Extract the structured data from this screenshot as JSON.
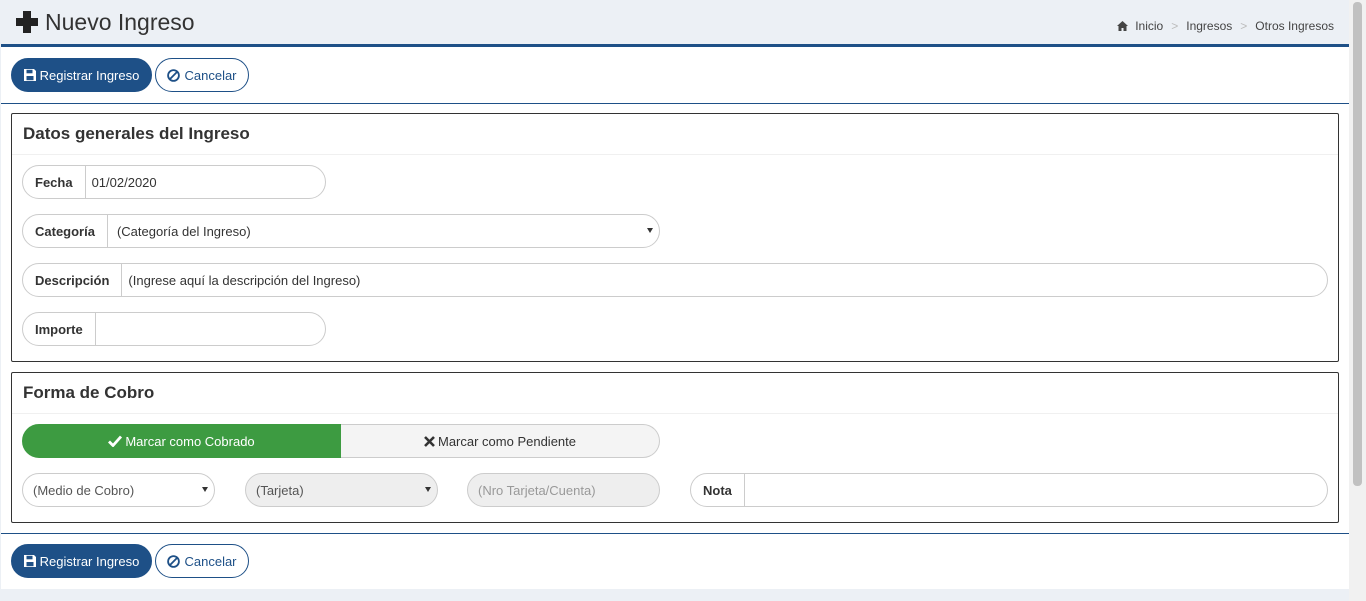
{
  "header": {
    "title": "Nuevo Ingreso",
    "breadcrumb": [
      "Inicio",
      "Ingresos",
      "Otros Ingresos"
    ]
  },
  "toolbar": {
    "save_label": "Registrar Ingreso",
    "cancel_label": "Cancelar"
  },
  "general": {
    "title": "Datos generales del Ingreso",
    "fecha_label": "Fecha",
    "fecha_value": "01/02/2020",
    "categoria_label": "Categoría",
    "categoria_value": "(Categoría del Ingreso)",
    "descripcion_label": "Descripción",
    "descripcion_placeholder": "(Ingrese aquí la descripción del Ingreso)",
    "importe_label": "Importe",
    "importe_value": ""
  },
  "cobro": {
    "title": "Forma de Cobro",
    "cobrado_label": "Marcar como Cobrado",
    "pendiente_label": "Marcar como Pendiente",
    "medio_value": "(Medio de Cobro)",
    "tarjeta_value": "(Tarjeta)",
    "nro_placeholder": "(Nro Tarjeta/Cuenta)",
    "nota_label": "Nota",
    "nota_value": ""
  },
  "colors": {
    "primary": "#1e5087",
    "success": "#3d9b41",
    "background": "#ecf0f5"
  },
  "icons": [
    "plus-icon",
    "home-icon",
    "save-icon",
    "ban-icon",
    "check-icon",
    "times-icon"
  ]
}
